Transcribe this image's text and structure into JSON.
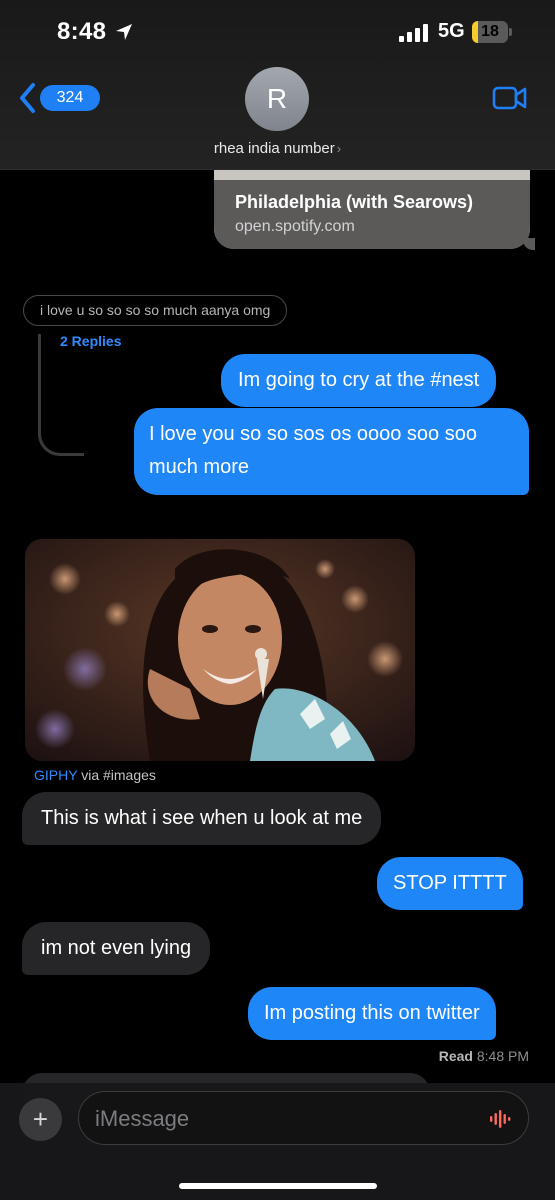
{
  "status_bar": {
    "time": "8:48",
    "network": "5G",
    "battery_level": "18",
    "location_icon": "location-arrow-icon",
    "signal_icon": "cellular-signal-icon"
  },
  "header": {
    "back_icon": "chevron-left-icon",
    "back_badge": "324",
    "avatar_initial": "R",
    "contact_name": "rhea india number",
    "contact_chevron": "›",
    "video_icon": "video-camera-icon"
  },
  "conversation": {
    "link_preview": {
      "title": "Philadelphia (with Searows)",
      "domain": "open.spotify.com"
    },
    "quoted_message": "i love u so so so so much aanya omg",
    "replies_label": "2 Replies",
    "messages": [
      {
        "sender": "me",
        "text": "Im going to cry at the #nest"
      },
      {
        "sender": "me",
        "text": "I love you so so sos os oooo soo soo much more"
      },
      {
        "sender": "them",
        "text": "This is what i see when u look at me"
      },
      {
        "sender": "me",
        "text": "STOP ITTTT"
      },
      {
        "sender": "them",
        "text": "im not even lying"
      },
      {
        "sender": "me",
        "text": "Im posting this on twitter"
      }
    ],
    "gif": {
      "source_brand": "GIPHY",
      "source_via": "via #images"
    },
    "receipt": {
      "status": "Read",
      "time": "8:48 PM"
    }
  },
  "composer": {
    "plus_label": "+",
    "placeholder": "iMessage",
    "voice_icon": "voice-waveform-icon"
  },
  "colors": {
    "outgoing_bubble": "#1f86f7",
    "incoming_bubble": "#262628",
    "accent": "#2f8cff",
    "battery_fill": "#f4cc2e"
  }
}
